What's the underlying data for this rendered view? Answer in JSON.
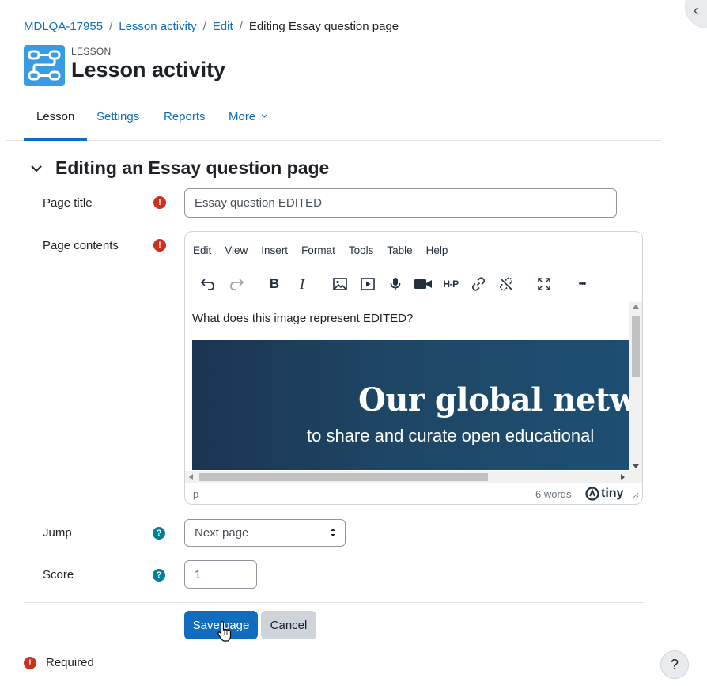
{
  "breadcrumb": {
    "items": [
      "MDLQA-17955",
      "Lesson activity",
      "Edit"
    ],
    "separator": "/",
    "current": "Editing Essay question page"
  },
  "header": {
    "module_label": "LESSON",
    "title": "Lesson activity",
    "icon_color": "#399be2"
  },
  "nav": {
    "tabs": [
      "Lesson",
      "Settings",
      "Reports",
      "More"
    ],
    "active": "Lesson"
  },
  "section": {
    "title": "Editing an Essay question page"
  },
  "form": {
    "page_title_label": "Page title",
    "page_title_value": "Essay question EDITED",
    "page_contents_label": "Page contents",
    "jump_label": "Jump",
    "jump_value": "Next page",
    "score_label": "Score",
    "score_value": "1",
    "required_mark": "!",
    "help_mark": "?"
  },
  "editor": {
    "menus": [
      "Edit",
      "View",
      "Insert",
      "Format",
      "Tools",
      "Table",
      "Help"
    ],
    "toolbar_icons": [
      "undo-icon",
      "redo-icon",
      "bold-icon",
      "italic-icon",
      "image-icon",
      "media-icon",
      "microphone-icon",
      "camera-icon",
      "h5p-icon",
      "link-icon",
      "unlink-icon",
      "fullscreen-icon",
      "more-icon"
    ],
    "bold_glyph": "B",
    "italic_glyph": "I",
    "h5p_label": "H-P",
    "more_glyph": "•••",
    "content_text": "What does this image represent EDITED?",
    "image_heading": "Our global networ",
    "image_subtext": "to share and curate open educational",
    "status_path": "p",
    "word_count": "6 words",
    "brand": "tiny"
  },
  "buttons": {
    "save": "Save page",
    "cancel": "Cancel"
  },
  "footer": {
    "required_text": "Required",
    "help_button": "?"
  },
  "colors": {
    "primary": "#0f6cbf",
    "required": "#ca3120",
    "help": "#008196"
  }
}
